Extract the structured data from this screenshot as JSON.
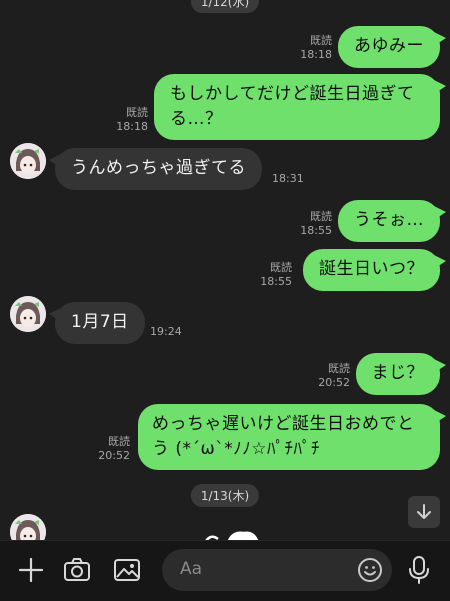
{
  "dates": {
    "top": "1/12(水)",
    "bottom": "1/13(木)"
  },
  "messages": [
    {
      "text": "あゆみー",
      "read": "既読",
      "time": "18:18"
    },
    {
      "text": "もしかしてだけど誕生日過ぎてる…？",
      "line1": "もしかしてだけど誕生日過ぎて",
      "line2": "る…？",
      "read": "既読",
      "time": "18:18"
    },
    {
      "text": "うんめっちゃ過ぎてる",
      "time": "18:31"
    },
    {
      "text": "うそぉ…",
      "read": "既読",
      "time": "18:55"
    },
    {
      "text": "誕生日いつ？",
      "read": "既読",
      "time": "18:55"
    },
    {
      "text": "1月7日",
      "time": "19:24"
    },
    {
      "text": "まじ？",
      "read": "既読",
      "time": "20:52"
    },
    {
      "line1": "めっちゃ遅いけど誕生日おめでと",
      "line2": "う (*´ω`*ﾉﾉ☆ﾊﾟﾁﾊﾟﾁ",
      "read": "既読",
      "time": "20:52"
    }
  ],
  "input": {
    "placeholder": "Aa"
  },
  "icons": {
    "add": "plus-icon",
    "camera": "camera-icon",
    "image": "image-icon",
    "emoji": "emoji-icon",
    "mic": "microphone-icon",
    "scroll": "arrow-down-icon"
  },
  "colors": {
    "background": "#1e1e1e",
    "outgoing_bubble": "#6fe06b",
    "incoming_bubble": "#343434"
  }
}
